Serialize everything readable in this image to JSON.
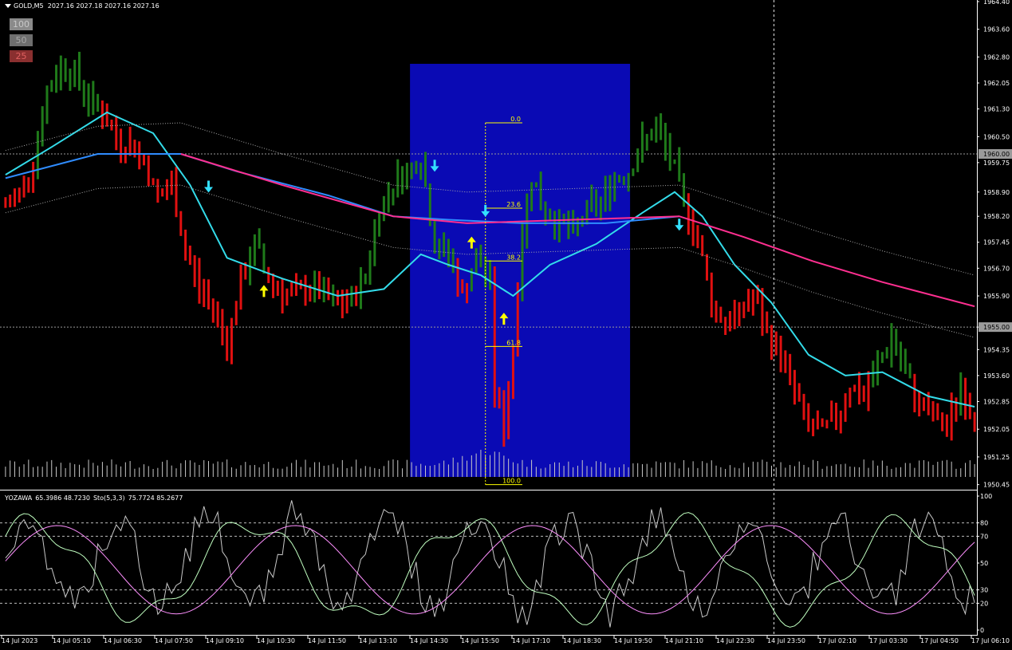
{
  "header": {
    "symbol": "GOLD,M5",
    "ohlc": "2027.16 2027.18 2027.16 2027.16"
  },
  "zoom_buttons": [
    {
      "label": "100",
      "bg": "#8a8a8a",
      "fg": "#c8c8c8"
    },
    {
      "label": "50",
      "bg": "#6e6e6e",
      "fg": "#a8a8a8"
    },
    {
      "label": "25",
      "bg": "#8a2f2f",
      "fg": "#e06060"
    }
  ],
  "indicator": {
    "name": "YOZAWA",
    "values": "65.3986 48.7230",
    "stoch": "Sto(5,3,3)",
    "stoch_values": "75.7724 85.2677"
  },
  "colors": {
    "background": "#000000",
    "bull_bar": "#1f7a1a",
    "bear_bar": "#e01010",
    "selection_box": "#0a0ab4",
    "ma_fast": "#33dcea",
    "ma_mid": "#2f8cff",
    "ma_slow": "#ff2f90",
    "fib": "#ffff00",
    "arrow_down": "#33e0ff",
    "arrow_up": "#ffff00",
    "grid": "#888888",
    "stoch_main": "#c8c8c8",
    "stoch_k": "#c0ffc0",
    "stoch_d": "#ff90ff"
  },
  "chart_data": {
    "type": "candlestick",
    "price_axis": {
      "ylim": [
        1950.35,
        1964.4
      ],
      "ticks": [
        "1964.40",
        "1963.60",
        "1962.80",
        "1962.05",
        "1961.30",
        "1960.50",
        "1959.75",
        "1958.90",
        "1958.20",
        "1957.45",
        "1956.70",
        "1955.90",
        "1955.00",
        "1954.35",
        "1953.60",
        "1952.85",
        "1952.05",
        "1951.25",
        "1950.45"
      ],
      "highlighted": [
        "1960.00",
        "1955.00"
      ]
    },
    "time_axis": {
      "labels": [
        "14 Jul 2023",
        "14 Jul 05:10",
        "14 Jul 06:30",
        "14 Jul 07:50",
        "14 Jul 09:10",
        "14 Jul 10:30",
        "14 Jul 11:50",
        "14 Jul 13:10",
        "14 Jul 14:30",
        "14 Jul 15:50",
        "14 Jul 17:10",
        "14 Jul 18:30",
        "14 Jul 19:50",
        "14 Jul 21:10",
        "14 Jul 22:30",
        "14 Jul 23:50",
        "17 Jul 02:10",
        "17 Jul 03:30",
        "17 Jul 04:50",
        "17 Jul 06:10"
      ]
    },
    "price_path": [
      [
        0,
        1958.5
      ],
      [
        3,
        1958.9
      ],
      [
        6,
        1959.8
      ],
      [
        9,
        1961.8
      ],
      [
        12,
        1962.6
      ],
      [
        15,
        1962.3
      ],
      [
        18,
        1961.6
      ],
      [
        21,
        1961.2
      ],
      [
        24,
        1960.4
      ],
      [
        27,
        1960.3
      ],
      [
        30,
        1959.8
      ],
      [
        33,
        1958.7
      ],
      [
        36,
        1959.1
      ],
      [
        39,
        1957.2
      ],
      [
        42,
        1956.1
      ],
      [
        45,
        1955.6
      ],
      [
        48,
        1954.5
      ],
      [
        51,
        1956.3
      ],
      [
        54,
        1957.4
      ],
      [
        57,
        1956.4
      ],
      [
        60,
        1956.0
      ],
      [
        63,
        1955.9
      ],
      [
        66,
        1956.2
      ],
      [
        69,
        1955.9
      ],
      [
        72,
        1955.6
      ],
      [
        75,
        1955.8
      ],
      [
        78,
        1956.5
      ],
      [
        81,
        1958.4
      ],
      [
        84,
        1959.2
      ],
      [
        87,
        1959.5
      ],
      [
        90,
        1959.9
      ],
      [
        93,
        1957.4
      ],
      [
        96,
        1957.1
      ],
      [
        99,
        1955.9
      ],
      [
        102,
        1957.0
      ],
      [
        105,
        1956.3
      ],
      [
        106,
        1953.2
      ],
      [
        108,
        1952.0
      ],
      [
        110,
        1954.5
      ],
      [
        112,
        1957.8
      ],
      [
        114,
        1959.4
      ],
      [
        116,
        1958.5
      ],
      [
        120,
        1958.0
      ],
      [
        123,
        1957.7
      ],
      [
        126,
        1958.4
      ],
      [
        129,
        1958.6
      ],
      [
        132,
        1959.3
      ],
      [
        135,
        1959.5
      ],
      [
        138,
        1960.3
      ],
      [
        141,
        1960.7
      ],
      [
        144,
        1959.9
      ],
      [
        147,
        1958.6
      ],
      [
        150,
        1957.6
      ],
      [
        153,
        1955.7
      ],
      [
        156,
        1955.1
      ],
      [
        159,
        1955.4
      ],
      [
        162,
        1955.9
      ],
      [
        165,
        1954.8
      ],
      [
        168,
        1954.2
      ],
      [
        171,
        1953.1
      ],
      [
        174,
        1952.1
      ],
      [
        177,
        1952.0
      ],
      [
        180,
        1952.4
      ],
      [
        183,
        1953.3
      ],
      [
        186,
        1953.0
      ],
      [
        189,
        1953.9
      ],
      [
        192,
        1954.7
      ],
      [
        195,
        1953.6
      ],
      [
        198,
        1952.8
      ],
      [
        201,
        1952.4
      ],
      [
        204,
        1952.1
      ],
      [
        207,
        1953.3
      ],
      [
        210,
        1952.3
      ]
    ],
    "moving_averages": [
      {
        "name": "fast",
        "points": [
          [
            0,
            1959.4
          ],
          [
            10,
            1960.2
          ],
          [
            22,
            1961.2
          ],
          [
            32,
            1960.6
          ],
          [
            40,
            1959.1
          ],
          [
            48,
            1957.0
          ],
          [
            60,
            1956.4
          ],
          [
            72,
            1955.9
          ],
          [
            82,
            1956.1
          ],
          [
            90,
            1957.1
          ],
          [
            96,
            1956.8
          ],
          [
            103,
            1956.5
          ],
          [
            110,
            1955.9
          ],
          [
            118,
            1956.8
          ],
          [
            128,
            1957.4
          ],
          [
            138,
            1958.3
          ],
          [
            145,
            1958.9
          ],
          [
            151,
            1958.2
          ],
          [
            158,
            1956.8
          ],
          [
            166,
            1955.7
          ],
          [
            174,
            1954.2
          ],
          [
            182,
            1953.6
          ],
          [
            190,
            1953.7
          ],
          [
            200,
            1953.0
          ],
          [
            210,
            1952.7
          ]
        ]
      },
      {
        "name": "mid",
        "points": [
          [
            0,
            1959.3
          ],
          [
            20,
            1960.0
          ],
          [
            38,
            1960.0
          ],
          [
            50,
            1959.5
          ],
          [
            70,
            1958.8
          ],
          [
            84,
            1958.2
          ],
          [
            96,
            1958.1
          ],
          [
            112,
            1958.0
          ],
          [
            130,
            1958.0
          ],
          [
            146,
            1958.2
          ]
        ]
      },
      {
        "name": "slow",
        "points": [
          [
            38,
            1960.0
          ],
          [
            60,
            1959.1
          ],
          [
            84,
            1958.2
          ],
          [
            100,
            1958.0
          ],
          [
            146,
            1958.2
          ],
          [
            160,
            1957.6
          ],
          [
            175,
            1956.9
          ],
          [
            190,
            1956.3
          ],
          [
            210,
            1955.6
          ]
        ]
      }
    ],
    "fibonacci": {
      "levels": [
        "0.0",
        "23.6",
        "38.2",
        "61.8",
        "100.0"
      ],
      "high": 1960.9,
      "low": 1950.45
    },
    "selection": {
      "from": 88,
      "to": 135
    },
    "arrows": [
      {
        "dir": "down",
        "at": 44,
        "price": 1959.0
      },
      {
        "dir": "up",
        "at": 56,
        "price": 1956.1
      },
      {
        "dir": "down",
        "at": 93,
        "price": 1959.6
      },
      {
        "dir": "up",
        "at": 101,
        "price": 1957.5
      },
      {
        "dir": "down",
        "at": 104,
        "price": 1958.3
      },
      {
        "dir": "up",
        "at": 108,
        "price": 1955.3
      },
      {
        "dir": "down",
        "at": 146,
        "price": 1957.9
      }
    ],
    "indicator_panel": {
      "levels": [
        "100",
        "80",
        "70",
        "50",
        "30",
        "20",
        "0"
      ],
      "dashed": [
        "80",
        "70",
        "30",
        "20"
      ]
    }
  }
}
